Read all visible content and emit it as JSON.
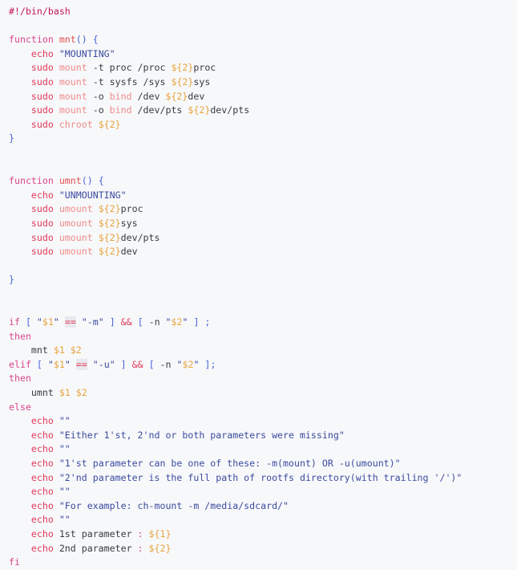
{
  "document": {
    "title": "ch-mount bash script",
    "language": "bash",
    "background_color": "#f7f8fa",
    "default_text_color": "#383a42"
  },
  "theme": {
    "comment": "#c2185b",
    "keyword": "#d9468c",
    "function_name": "#e05252",
    "builtin": "#e03a5a",
    "command": "#ef8b8b",
    "string": "#3b4b9e",
    "variable": "#e8a33d",
    "punctuation": "#4a63d8",
    "plain": "#383a42",
    "operator_highlight_bg": "#e8e9ee"
  },
  "code": {
    "lines": [
      {
        "n": 1,
        "tokens": [
          {
            "t": "#!/bin/bash",
            "c": "t-comment"
          }
        ]
      },
      {
        "n": 2,
        "tokens": []
      },
      {
        "n": 3,
        "tokens": [
          {
            "t": "function",
            "c": "t-kw"
          },
          {
            "t": " ",
            "c": "t-plain"
          },
          {
            "t": "mnt",
            "c": "t-fname"
          },
          {
            "t": "()",
            "c": "t-punc"
          },
          {
            "t": " ",
            "c": "t-plain"
          },
          {
            "t": "{",
            "c": "t-punc"
          }
        ]
      },
      {
        "n": 4,
        "tokens": [
          {
            "t": "    ",
            "c": "t-plain"
          },
          {
            "t": "echo",
            "c": "t-builtin"
          },
          {
            "t": " ",
            "c": "t-plain"
          },
          {
            "t": "\"MOUNTING\"",
            "c": "t-string"
          }
        ]
      },
      {
        "n": 5,
        "tokens": [
          {
            "t": "    ",
            "c": "t-plain"
          },
          {
            "t": "sudo",
            "c": "t-builtin"
          },
          {
            "t": " ",
            "c": "t-plain"
          },
          {
            "t": "mount",
            "c": "t-cmd"
          },
          {
            "t": " -t proc /proc ",
            "c": "t-plain"
          },
          {
            "t": "${2}",
            "c": "t-var"
          },
          {
            "t": "proc",
            "c": "t-plain"
          }
        ]
      },
      {
        "n": 6,
        "tokens": [
          {
            "t": "    ",
            "c": "t-plain"
          },
          {
            "t": "sudo",
            "c": "t-builtin"
          },
          {
            "t": " ",
            "c": "t-plain"
          },
          {
            "t": "mount",
            "c": "t-cmd"
          },
          {
            "t": " -t sysfs /sys ",
            "c": "t-plain"
          },
          {
            "t": "${2}",
            "c": "t-var"
          },
          {
            "t": "sys",
            "c": "t-plain"
          }
        ]
      },
      {
        "n": 7,
        "tokens": [
          {
            "t": "    ",
            "c": "t-plain"
          },
          {
            "t": "sudo",
            "c": "t-builtin"
          },
          {
            "t": " ",
            "c": "t-plain"
          },
          {
            "t": "mount",
            "c": "t-cmd"
          },
          {
            "t": " -o ",
            "c": "t-plain"
          },
          {
            "t": "bind",
            "c": "t-cmd"
          },
          {
            "t": " /dev ",
            "c": "t-plain"
          },
          {
            "t": "${2}",
            "c": "t-var"
          },
          {
            "t": "dev",
            "c": "t-plain"
          }
        ]
      },
      {
        "n": 8,
        "tokens": [
          {
            "t": "    ",
            "c": "t-plain"
          },
          {
            "t": "sudo",
            "c": "t-builtin"
          },
          {
            "t": " ",
            "c": "t-plain"
          },
          {
            "t": "mount",
            "c": "t-cmd"
          },
          {
            "t": " -o ",
            "c": "t-plain"
          },
          {
            "t": "bind",
            "c": "t-cmd"
          },
          {
            "t": " /dev/pts ",
            "c": "t-plain"
          },
          {
            "t": "${2}",
            "c": "t-var"
          },
          {
            "t": "dev/pts",
            "c": "t-plain"
          }
        ]
      },
      {
        "n": 9,
        "tokens": [
          {
            "t": "    ",
            "c": "t-plain"
          },
          {
            "t": "sudo",
            "c": "t-builtin"
          },
          {
            "t": " ",
            "c": "t-plain"
          },
          {
            "t": "chroot",
            "c": "t-cmd"
          },
          {
            "t": " ",
            "c": "t-plain"
          },
          {
            "t": "${2}",
            "c": "t-var"
          }
        ]
      },
      {
        "n": 10,
        "tokens": [
          {
            "t": "}",
            "c": "t-punc"
          }
        ]
      },
      {
        "n": 11,
        "tokens": []
      },
      {
        "n": 12,
        "tokens": []
      },
      {
        "n": 13,
        "tokens": [
          {
            "t": "function",
            "c": "t-kw"
          },
          {
            "t": " ",
            "c": "t-plain"
          },
          {
            "t": "umnt",
            "c": "t-fname"
          },
          {
            "t": "()",
            "c": "t-punc"
          },
          {
            "t": " ",
            "c": "t-plain"
          },
          {
            "t": "{",
            "c": "t-punc"
          }
        ]
      },
      {
        "n": 14,
        "tokens": [
          {
            "t": "    ",
            "c": "t-plain"
          },
          {
            "t": "echo",
            "c": "t-builtin"
          },
          {
            "t": " ",
            "c": "t-plain"
          },
          {
            "t": "\"UNMOUNTING\"",
            "c": "t-string"
          }
        ]
      },
      {
        "n": 15,
        "tokens": [
          {
            "t": "    ",
            "c": "t-plain"
          },
          {
            "t": "sudo",
            "c": "t-builtin"
          },
          {
            "t": " ",
            "c": "t-plain"
          },
          {
            "t": "umount",
            "c": "t-cmd"
          },
          {
            "t": " ",
            "c": "t-plain"
          },
          {
            "t": "${2}",
            "c": "t-var"
          },
          {
            "t": "proc",
            "c": "t-plain"
          }
        ]
      },
      {
        "n": 16,
        "tokens": [
          {
            "t": "    ",
            "c": "t-plain"
          },
          {
            "t": "sudo",
            "c": "t-builtin"
          },
          {
            "t": " ",
            "c": "t-plain"
          },
          {
            "t": "umount",
            "c": "t-cmd"
          },
          {
            "t": " ",
            "c": "t-plain"
          },
          {
            "t": "${2}",
            "c": "t-var"
          },
          {
            "t": "sys",
            "c": "t-plain"
          }
        ]
      },
      {
        "n": 17,
        "tokens": [
          {
            "t": "    ",
            "c": "t-plain"
          },
          {
            "t": "sudo",
            "c": "t-builtin"
          },
          {
            "t": " ",
            "c": "t-plain"
          },
          {
            "t": "umount",
            "c": "t-cmd"
          },
          {
            "t": " ",
            "c": "t-plain"
          },
          {
            "t": "${2}",
            "c": "t-var"
          },
          {
            "t": "dev/pts",
            "c": "t-plain"
          }
        ]
      },
      {
        "n": 18,
        "tokens": [
          {
            "t": "    ",
            "c": "t-plain"
          },
          {
            "t": "sudo",
            "c": "t-builtin"
          },
          {
            "t": " ",
            "c": "t-plain"
          },
          {
            "t": "umount",
            "c": "t-cmd"
          },
          {
            "t": " ",
            "c": "t-plain"
          },
          {
            "t": "${2}",
            "c": "t-var"
          },
          {
            "t": "dev",
            "c": "t-plain"
          }
        ]
      },
      {
        "n": 19,
        "tokens": []
      },
      {
        "n": 20,
        "tokens": [
          {
            "t": "}",
            "c": "t-punc"
          }
        ]
      },
      {
        "n": 21,
        "tokens": []
      },
      {
        "n": 22,
        "tokens": []
      },
      {
        "n": 23,
        "tokens": [
          {
            "t": "if",
            "c": "t-kw"
          },
          {
            "t": " ",
            "c": "t-plain"
          },
          {
            "t": "[",
            "c": "t-punc"
          },
          {
            "t": " ",
            "c": "t-plain"
          },
          {
            "t": "\"",
            "c": "t-string"
          },
          {
            "t": "$1",
            "c": "t-var"
          },
          {
            "t": "\"",
            "c": "t-string"
          },
          {
            "t": " ",
            "c": "t-plain"
          },
          {
            "t": "==",
            "c": "t-op"
          },
          {
            "t": " ",
            "c": "t-plain"
          },
          {
            "t": "\"-m\"",
            "c": "t-string"
          },
          {
            "t": " ",
            "c": "t-plain"
          },
          {
            "t": "]",
            "c": "t-punc"
          },
          {
            "t": " ",
            "c": "t-plain"
          },
          {
            "t": "&&",
            "c": "t-builtin"
          },
          {
            "t": " ",
            "c": "t-plain"
          },
          {
            "t": "[",
            "c": "t-punc"
          },
          {
            "t": " -n ",
            "c": "t-plain"
          },
          {
            "t": "\"",
            "c": "t-string"
          },
          {
            "t": "$2",
            "c": "t-var"
          },
          {
            "t": "\"",
            "c": "t-string"
          },
          {
            "t": " ",
            "c": "t-plain"
          },
          {
            "t": "]",
            "c": "t-punc"
          },
          {
            "t": " ",
            "c": "t-plain"
          },
          {
            "t": ";",
            "c": "t-punc"
          }
        ]
      },
      {
        "n": 24,
        "tokens": [
          {
            "t": "then",
            "c": "t-kw"
          }
        ]
      },
      {
        "n": 25,
        "tokens": [
          {
            "t": "    ",
            "c": "t-plain"
          },
          {
            "t": "mnt",
            "c": "t-plain"
          },
          {
            "t": " ",
            "c": "t-plain"
          },
          {
            "t": "$1",
            "c": "t-var"
          },
          {
            "t": " ",
            "c": "t-plain"
          },
          {
            "t": "$2",
            "c": "t-var"
          }
        ]
      },
      {
        "n": 26,
        "tokens": [
          {
            "t": "elif",
            "c": "t-kw"
          },
          {
            "t": " ",
            "c": "t-plain"
          },
          {
            "t": "[",
            "c": "t-punc"
          },
          {
            "t": " ",
            "c": "t-plain"
          },
          {
            "t": "\"",
            "c": "t-string"
          },
          {
            "t": "$1",
            "c": "t-var"
          },
          {
            "t": "\"",
            "c": "t-string"
          },
          {
            "t": " ",
            "c": "t-plain"
          },
          {
            "t": "==",
            "c": "t-op"
          },
          {
            "t": " ",
            "c": "t-plain"
          },
          {
            "t": "\"-u\"",
            "c": "t-string"
          },
          {
            "t": " ",
            "c": "t-plain"
          },
          {
            "t": "]",
            "c": "t-punc"
          },
          {
            "t": " ",
            "c": "t-plain"
          },
          {
            "t": "&&",
            "c": "t-builtin"
          },
          {
            "t": " ",
            "c": "t-plain"
          },
          {
            "t": "[",
            "c": "t-punc"
          },
          {
            "t": " -n ",
            "c": "t-plain"
          },
          {
            "t": "\"",
            "c": "t-string"
          },
          {
            "t": "$2",
            "c": "t-var"
          },
          {
            "t": "\"",
            "c": "t-string"
          },
          {
            "t": " ",
            "c": "t-plain"
          },
          {
            "t": "]",
            "c": "t-punc"
          },
          {
            "t": ";",
            "c": "t-punc"
          }
        ]
      },
      {
        "n": 27,
        "tokens": [
          {
            "t": "then",
            "c": "t-kw"
          }
        ]
      },
      {
        "n": 28,
        "tokens": [
          {
            "t": "    ",
            "c": "t-plain"
          },
          {
            "t": "umnt",
            "c": "t-plain"
          },
          {
            "t": " ",
            "c": "t-plain"
          },
          {
            "t": "$1",
            "c": "t-var"
          },
          {
            "t": " ",
            "c": "t-plain"
          },
          {
            "t": "$2",
            "c": "t-var"
          }
        ]
      },
      {
        "n": 29,
        "tokens": [
          {
            "t": "else",
            "c": "t-kw"
          }
        ]
      },
      {
        "n": 30,
        "tokens": [
          {
            "t": "    ",
            "c": "t-plain"
          },
          {
            "t": "echo",
            "c": "t-builtin"
          },
          {
            "t": " ",
            "c": "t-plain"
          },
          {
            "t": "\"\"",
            "c": "t-string"
          }
        ]
      },
      {
        "n": 31,
        "tokens": [
          {
            "t": "    ",
            "c": "t-plain"
          },
          {
            "t": "echo",
            "c": "t-builtin"
          },
          {
            "t": " ",
            "c": "t-plain"
          },
          {
            "t": "\"Either 1'st, 2'nd or both parameters were missing\"",
            "c": "t-string"
          }
        ]
      },
      {
        "n": 32,
        "tokens": [
          {
            "t": "    ",
            "c": "t-plain"
          },
          {
            "t": "echo",
            "c": "t-builtin"
          },
          {
            "t": " ",
            "c": "t-plain"
          },
          {
            "t": "\"\"",
            "c": "t-string"
          }
        ]
      },
      {
        "n": 33,
        "tokens": [
          {
            "t": "    ",
            "c": "t-plain"
          },
          {
            "t": "echo",
            "c": "t-builtin"
          },
          {
            "t": " ",
            "c": "t-plain"
          },
          {
            "t": "\"1'st parameter can be one of these: -m(mount) OR -u(umount)\"",
            "c": "t-string"
          }
        ]
      },
      {
        "n": 34,
        "tokens": [
          {
            "t": "    ",
            "c": "t-plain"
          },
          {
            "t": "echo",
            "c": "t-builtin"
          },
          {
            "t": " ",
            "c": "t-plain"
          },
          {
            "t": "\"2'nd parameter is the full path of rootfs directory(with trailing '/')\"",
            "c": "t-string"
          }
        ]
      },
      {
        "n": 35,
        "tokens": [
          {
            "t": "    ",
            "c": "t-plain"
          },
          {
            "t": "echo",
            "c": "t-builtin"
          },
          {
            "t": " ",
            "c": "t-plain"
          },
          {
            "t": "\"\"",
            "c": "t-string"
          }
        ]
      },
      {
        "n": 36,
        "tokens": [
          {
            "t": "    ",
            "c": "t-plain"
          },
          {
            "t": "echo",
            "c": "t-builtin"
          },
          {
            "t": " ",
            "c": "t-plain"
          },
          {
            "t": "\"For example: ch-mount -m /media/sdcard/\"",
            "c": "t-string"
          }
        ]
      },
      {
        "n": 37,
        "tokens": [
          {
            "t": "    ",
            "c": "t-plain"
          },
          {
            "t": "echo",
            "c": "t-builtin"
          },
          {
            "t": " ",
            "c": "t-plain"
          },
          {
            "t": "\"\"",
            "c": "t-string"
          }
        ]
      },
      {
        "n": 38,
        "tokens": [
          {
            "t": "    ",
            "c": "t-plain"
          },
          {
            "t": "echo",
            "c": "t-builtin"
          },
          {
            "t": " 1st parameter ",
            "c": "t-plain"
          },
          {
            "t": ":",
            "c": "t-colon"
          },
          {
            "t": " ",
            "c": "t-plain"
          },
          {
            "t": "${1}",
            "c": "t-var"
          }
        ]
      },
      {
        "n": 39,
        "tokens": [
          {
            "t": "    ",
            "c": "t-plain"
          },
          {
            "t": "echo",
            "c": "t-builtin"
          },
          {
            "t": " 2nd parameter ",
            "c": "t-plain"
          },
          {
            "t": ":",
            "c": "t-colon"
          },
          {
            "t": " ",
            "c": "t-plain"
          },
          {
            "t": "${2}",
            "c": "t-var"
          }
        ]
      },
      {
        "n": 40,
        "tokens": [
          {
            "t": "fi",
            "c": "t-kw"
          }
        ]
      }
    ]
  }
}
